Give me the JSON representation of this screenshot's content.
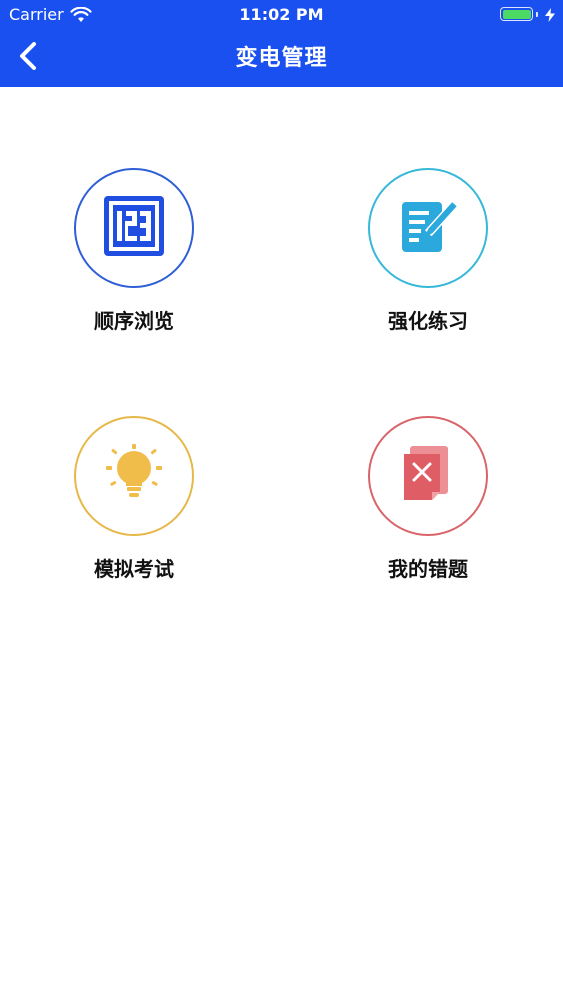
{
  "status_bar": {
    "carrier": "Carrier",
    "time": "11:02 PM"
  },
  "nav": {
    "title": "变电管理",
    "back_icon": "chevron-left-icon"
  },
  "colors": {
    "nav_background": "#1a50f0",
    "sequential_accent": "#2f5fd6",
    "practice_accent": "#36b8d8",
    "exam_accent": "#e6b84a",
    "mistakes_accent": "#d9656a"
  },
  "menu": {
    "sequential": {
      "label": "顺序浏览",
      "icon": "number-123-icon"
    },
    "practice": {
      "label": "强化练习",
      "icon": "document-edit-icon"
    },
    "exam": {
      "label": "模拟考试",
      "icon": "lightbulb-icon"
    },
    "mistakes": {
      "label": "我的错题",
      "icon": "wrong-document-icon"
    }
  }
}
